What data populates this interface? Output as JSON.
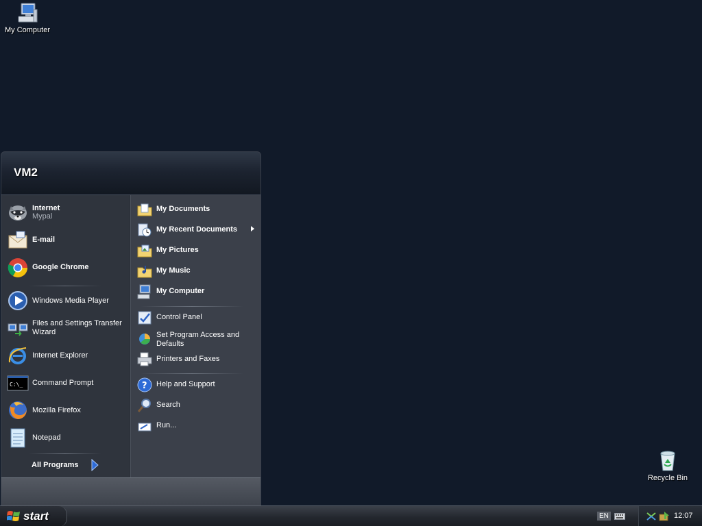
{
  "desktop": {
    "icons": [
      {
        "label": "My Computer",
        "icon": "my-computer-icon"
      },
      {
        "label": "Recycle Bin",
        "icon": "recycle-bin-icon"
      }
    ]
  },
  "start_menu": {
    "user_name": "VM2",
    "pinned": [
      {
        "title": "Internet",
        "subtitle": "Mypal",
        "icon": "mypal-raccoon-icon"
      },
      {
        "title": "E-mail",
        "icon": "email-icon"
      },
      {
        "title": "Google Chrome",
        "icon": "chrome-icon"
      }
    ],
    "recent": [
      {
        "title": "Windows Media Player",
        "icon": "media-player-icon"
      },
      {
        "title": "Files and Settings Transfer Wizard",
        "icon": "transfer-wizard-icon"
      },
      {
        "title": "Internet Explorer",
        "icon": "internet-explorer-icon"
      },
      {
        "title": "Command Prompt",
        "icon": "command-prompt-icon"
      },
      {
        "title": "Mozilla Firefox",
        "icon": "firefox-icon"
      },
      {
        "title": "Notepad",
        "icon": "notepad-icon"
      }
    ],
    "all_programs": "All Programs",
    "places": [
      {
        "title": "My Documents",
        "icon": "documents-folder-icon"
      },
      {
        "title": "My Recent Documents",
        "icon": "recent-documents-icon"
      },
      {
        "title": "My Pictures",
        "icon": "pictures-folder-icon"
      },
      {
        "title": "My Music",
        "icon": "music-folder-icon"
      },
      {
        "title": "My Computer",
        "icon": "my-computer-icon"
      }
    ],
    "system": [
      {
        "title": "Control Panel",
        "icon": "control-panel-icon"
      },
      {
        "title": "Set Program Access and Defaults",
        "icon": "program-defaults-icon"
      },
      {
        "title": "Printers and Faxes",
        "icon": "printer-icon"
      }
    ],
    "help": [
      {
        "title": "Help and Support",
        "icon": "help-icon"
      },
      {
        "title": "Search",
        "icon": "search-icon"
      },
      {
        "title": "Run...",
        "icon": "run-icon"
      }
    ]
  },
  "taskbar": {
    "start_label": "start",
    "language": "EN",
    "clock": "12:07"
  },
  "colors": {
    "desktop_bg": "#111a29",
    "menu_left": "#2f343d",
    "menu_right": "#3b404a"
  }
}
